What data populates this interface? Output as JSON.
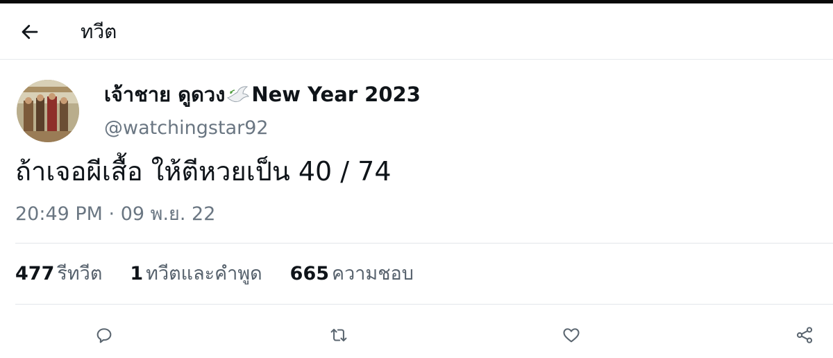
{
  "header": {
    "title": "ทวีต",
    "back_icon": "arrow-left-icon"
  },
  "tweet": {
    "display_name_prefix": "เจ้าชาย ดูดวง",
    "display_name_emoji": "dove-icon",
    "display_name_suffix": "New Year 2023",
    "handle": "@watchingstar92",
    "text": "ถ้าเจอผีเสื้อ ให้ตีหวยเป็น 40 / 74",
    "timestamp": "20:49 PM · 09 พ.ย. 22"
  },
  "stats": [
    {
      "count": "477",
      "label": "รีทวีต"
    },
    {
      "count": "1",
      "label": "ทวีตและคำพูด"
    },
    {
      "count": "665",
      "label": "ความชอบ"
    }
  ],
  "actions": [
    {
      "name": "reply",
      "icon": "speech-bubble-icon"
    },
    {
      "name": "retweet",
      "icon": "retweet-arrows-icon"
    },
    {
      "name": "like",
      "icon": "heart-icon"
    },
    {
      "name": "share",
      "icon": "share-nodes-icon"
    }
  ],
  "colors": {
    "text": "#0f1419",
    "secondary": "#6a7682",
    "divider": "#e2e6ea",
    "icon": "#5b6670"
  }
}
